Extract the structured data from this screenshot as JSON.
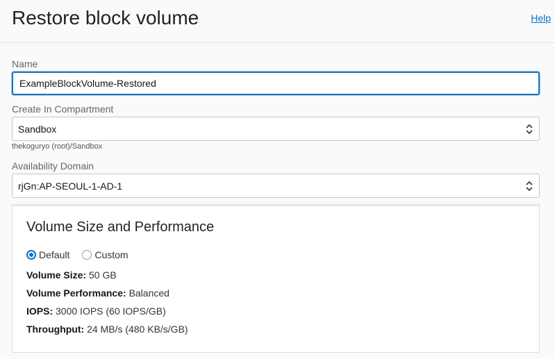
{
  "header": {
    "title": "Restore block volume",
    "help_label": "Help"
  },
  "form": {
    "name": {
      "label": "Name",
      "value": "ExampleBlockVolume-Restored"
    },
    "compartment": {
      "label": "Create In Compartment",
      "value": "Sandbox",
      "hint": "thekoguryo (root)/Sandbox"
    },
    "availability_domain": {
      "label": "Availability Domain",
      "value": "rjGn:AP-SEOUL-1-AD-1"
    }
  },
  "volume_panel": {
    "title": "Volume Size and Performance",
    "options": [
      {
        "label": "Default",
        "selected": true
      },
      {
        "label": "Custom",
        "selected": false
      }
    ],
    "details": [
      {
        "label": "Volume Size:",
        "value": "50 GB"
      },
      {
        "label": "Volume Performance:",
        "value": "Balanced"
      },
      {
        "label": "IOPS:",
        "value": "3000 IOPS (60 IOPS/GB)"
      },
      {
        "label": "Throughput:",
        "value": "24 MB/s (480 KB/s/GB)"
      }
    ]
  },
  "colors": {
    "accent": "#0572ce",
    "focus_border": "#1e73b9",
    "background": "#fafafa"
  },
  "icons": {
    "select_chevron": "chevron-up-down-icon",
    "radio": "radio-icon"
  }
}
